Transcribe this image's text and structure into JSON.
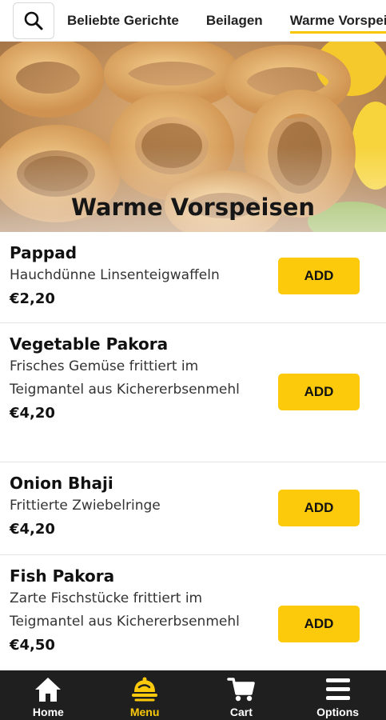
{
  "topbar": {
    "search_icon": "search-icon",
    "tabs": [
      {
        "label": "Beliebte Gerichte"
      },
      {
        "label": "Beilagen"
      },
      {
        "label": "Warme Vorspeisen"
      }
    ],
    "active_tab": "Warme Vorspeisen"
  },
  "hero": {
    "title": "Warme Vorspeisen"
  },
  "items": [
    {
      "name": "Pappad",
      "description": "Hauchdünne Linsenteigwaffeln",
      "price": "€2,20",
      "add_label": "ADD"
    },
    {
      "name": "Vegetable Pakora",
      "description": "Frisches Gemüse frittiert im Teigmantel aus Kichererbsenmehl",
      "price": "€4,20",
      "add_label": "ADD"
    },
    {
      "name": "Onion Bhaji",
      "description": "Frittierte Zwiebelringe",
      "price": "€4,20",
      "add_label": "ADD"
    },
    {
      "name": "Fish Pakora",
      "description": "Zarte Fischstücke frittiert im Teigmantel aus Kichererbsenmehl",
      "price": "€4,50",
      "add_label": "ADD"
    }
  ],
  "bottomnav": {
    "items": [
      {
        "label": "Home",
        "icon": "home-icon"
      },
      {
        "label": "Menu",
        "icon": "menu-icon"
      },
      {
        "label": "Cart",
        "icon": "cart-icon"
      },
      {
        "label": "Options",
        "icon": "options-icon"
      }
    ],
    "active": "Menu"
  },
  "colors": {
    "accent": "#fcca0a",
    "nav_background": "#1f1f1f"
  }
}
